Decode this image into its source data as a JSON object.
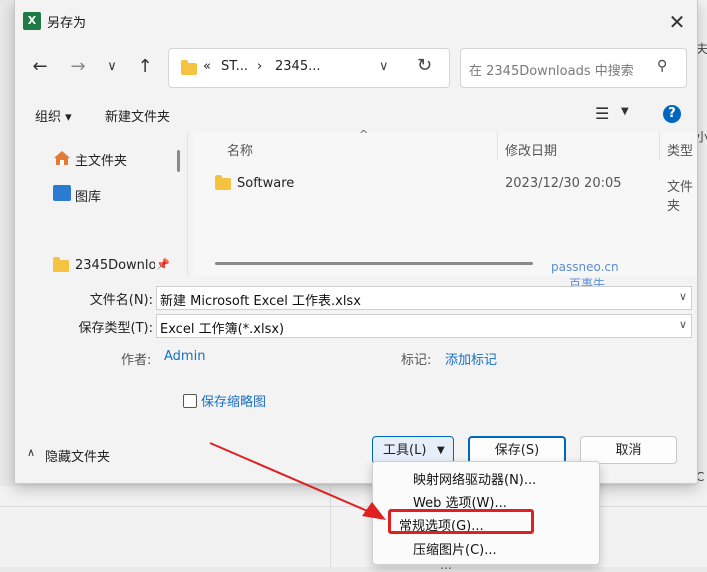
{
  "window": {
    "title": "另存为",
    "app_icon": "excel-icon"
  },
  "address": {
    "crumbs": [
      "«",
      "ST...",
      "›",
      "2345..."
    ]
  },
  "search": {
    "placeholder": "在 2345Downloads 中搜索"
  },
  "toolbar": {
    "organize": "组织 ▾",
    "new_folder": "新建文件夹"
  },
  "sidebar": {
    "items": [
      {
        "label": "主文件夹",
        "icon": "home-icon"
      },
      {
        "label": "图库",
        "icon": "gallery-icon"
      },
      {
        "label": "2345Downlo",
        "icon": "folder-icon"
      }
    ]
  },
  "filelist": {
    "columns": [
      "名称",
      "修改日期",
      "类型"
    ],
    "rows": [
      {
        "name": "Software",
        "date": "2023/12/30 20:05",
        "type": "文件夹"
      }
    ]
  },
  "watermark": {
    "line1": "passneo.cn",
    "line2": "百事牛"
  },
  "form": {
    "filename_label": "文件名(N):",
    "filename_value": "新建 Microsoft Excel 工作表.xlsx",
    "filetype_label": "保存类型(T):",
    "filetype_value": "Excel 工作簿(*.xlsx)",
    "author_label": "作者:",
    "author_value": "Admin",
    "tags_label": "标记:",
    "tags_value": "添加标记",
    "thumbnail_label": "保存缩略图"
  },
  "bottom": {
    "hide_folders": "隐藏文件夹",
    "tools": "工具(L)",
    "save": "保存(S)",
    "cancel": "取消"
  },
  "tools_menu": {
    "items": [
      "映射网络驱动器(N)...",
      "Web 选项(W)...",
      "常规选项(G)...",
      "压缩图片(C)..."
    ]
  },
  "background": {
    "right_glyphs": [
      "夫",
      "小",
      "C"
    ],
    "bottom_text": "…"
  },
  "colors": {
    "accent": "#0067c0",
    "highlight": "#e02020",
    "folder": "#f5c242",
    "excel": "#1e7b45"
  }
}
